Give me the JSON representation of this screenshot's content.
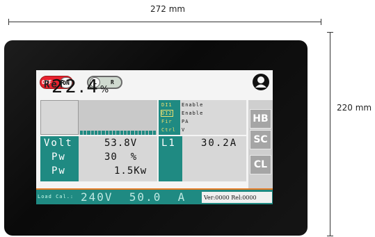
{
  "dimensions": {
    "width_label": "272 mm",
    "height_label": "220 mm"
  },
  "topbar": {
    "power_toggle": {
      "off_label": "OFF",
      "on_label": "ON",
      "state": "ON"
    },
    "lr_toggle": {
      "left_label": "L",
      "right_label": "R"
    },
    "user_icon": "user-icon"
  },
  "ref": {
    "label": "Ref",
    "value": "22.4",
    "unit": "%"
  },
  "inputs": [
    {
      "key": "DI1",
      "value": "Enable"
    },
    {
      "key": "DI2",
      "value": "Enable"
    },
    {
      "key": "Fir",
      "value": "PA"
    },
    {
      "key": "Ctrl",
      "value": "V"
    }
  ],
  "readings": {
    "volt": {
      "label": "Volt",
      "value": "53.8V"
    },
    "pw1": {
      "label": "Pw",
      "value": "30  %"
    },
    "pw2": {
      "label": "Pw",
      "value": "1.5Kw"
    }
  },
  "l1": {
    "label": "L1",
    "value": "30.2A"
  },
  "side_buttons": [
    "HB",
    "SC",
    "CL"
  ],
  "footer": {
    "load_label": "Load Cal.:",
    "load_value": "240V  50.0  A",
    "version": "Ver:0000 Rel:0000"
  },
  "colors": {
    "teal": "#1f8a82",
    "accent_orange": "#e77b24",
    "toggle_red": "#e8212e"
  }
}
